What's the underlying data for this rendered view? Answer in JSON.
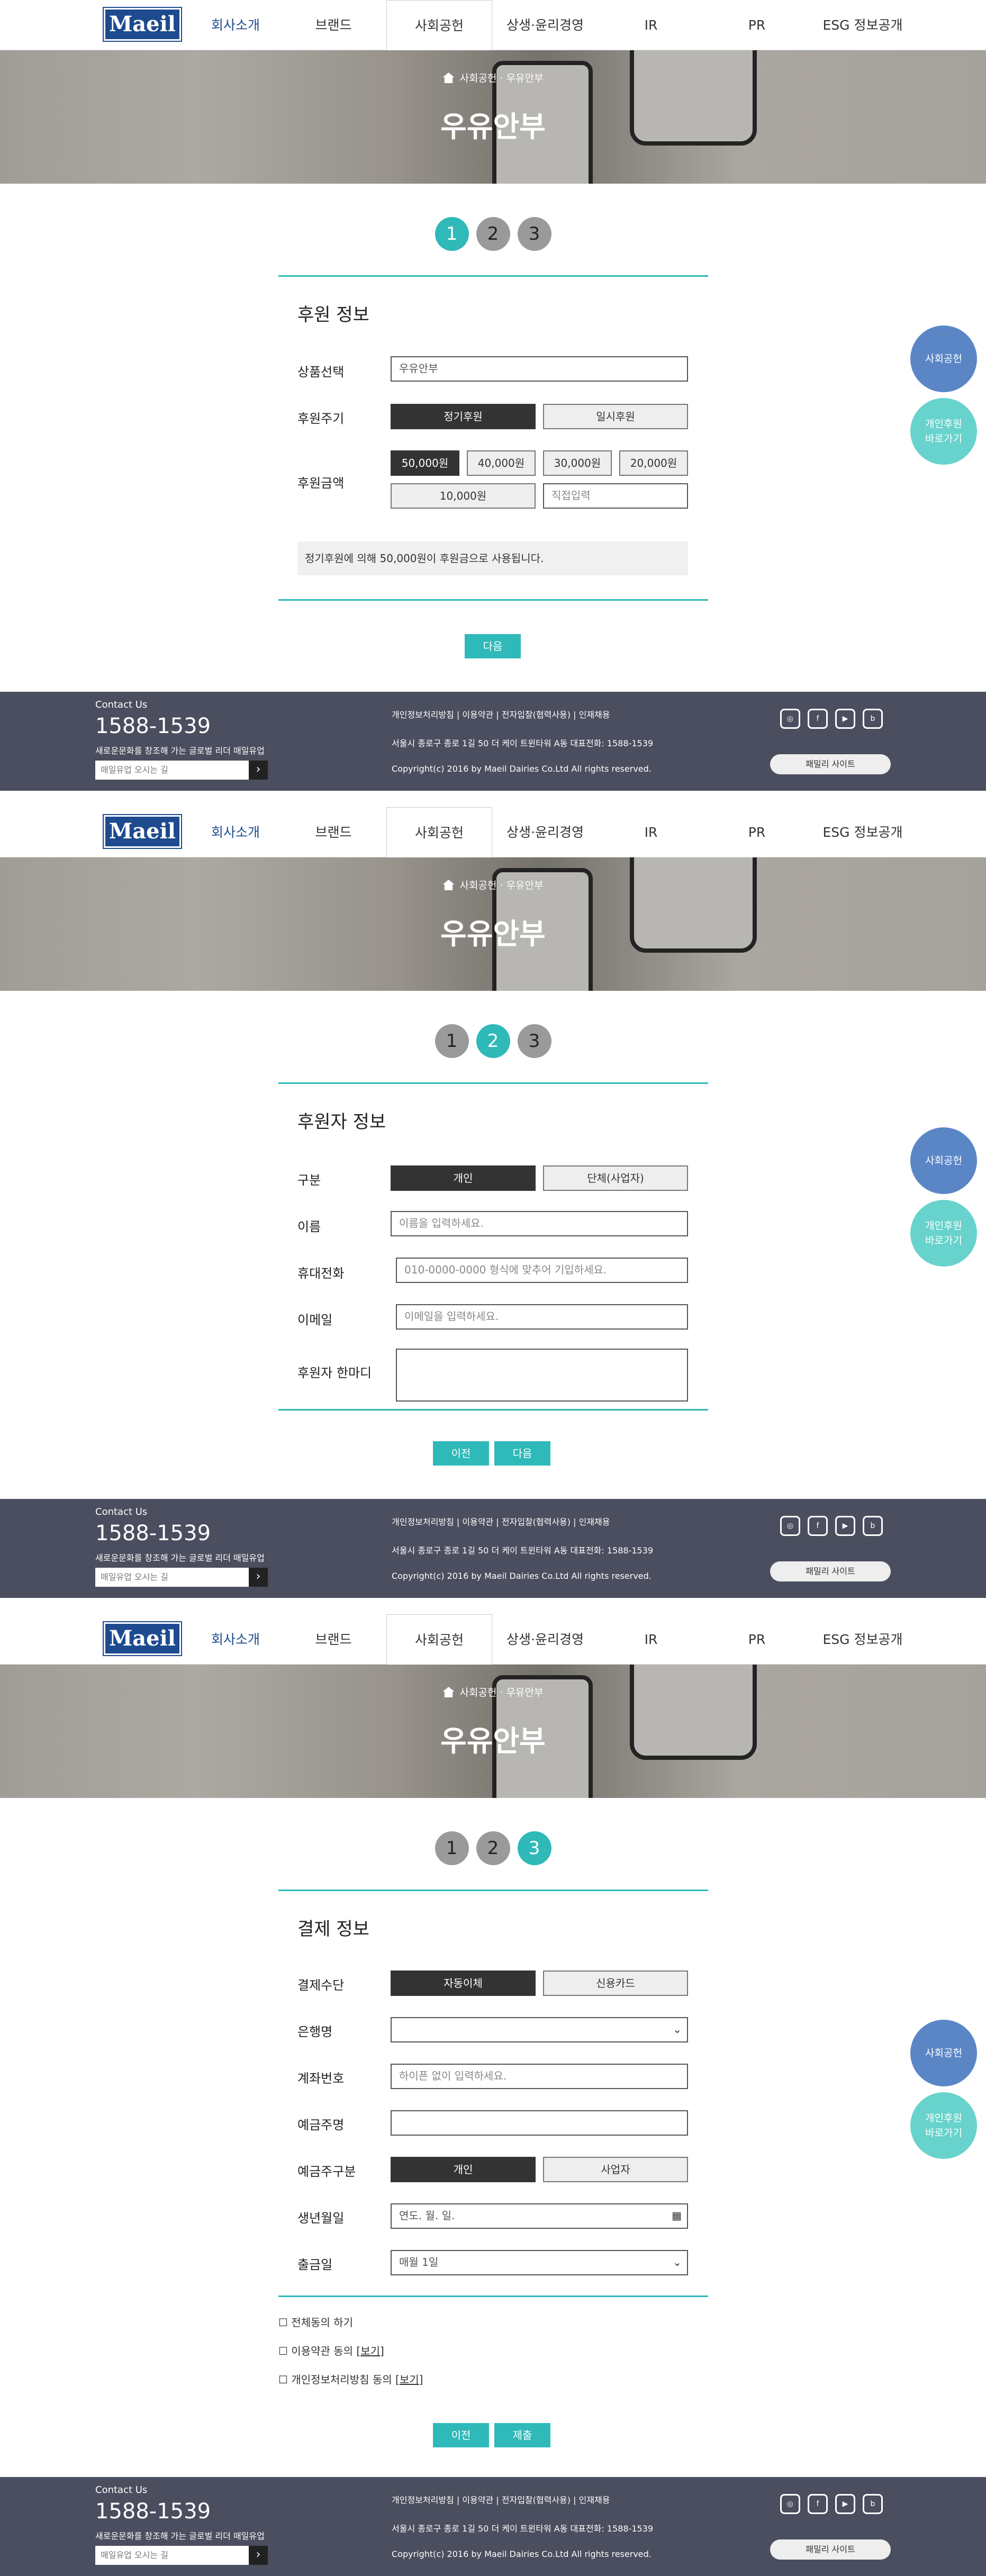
{
  "header": {
    "logo": "Maeil",
    "nav": [
      "회사소개",
      "브랜드",
      "사회공헌",
      "상생·윤리경영",
      "IR",
      "PR",
      "ESG 정보공개"
    ]
  },
  "hero": {
    "breadcrumb": "사회공헌 · 우유안부",
    "title": "우유안부"
  },
  "floating": {
    "social": "사회공헌",
    "privacy_line1": "개인후원",
    "privacy_line2": "바로가기"
  },
  "footer": {
    "contact": "Contact Us",
    "tel": "1588-1539",
    "slogan": "새로운문화를 창조해 가는 글로벌 리더 매일유업",
    "search_placeholder": "매일유업 오시는 길",
    "search_btn": "›",
    "links": "개인정보처리방침 | 이용약관 | 전자입찰(협력사용) | 인재채용",
    "address": "서울시 종로구 종로 1길 50 더 케이 트윈타워 A동 대표전화: 1588-1539",
    "copyright": "Copyright(c) 2016 by Maeil Dairies Co.Ltd All rights reserved.",
    "icons": [
      "instagram-icon",
      "facebook-icon",
      "youtube-icon",
      "blog-icon"
    ],
    "family": "패밀리 사이트"
  },
  "step1": {
    "steps": [
      "1",
      "2",
      "3"
    ],
    "heading": "후원 정보",
    "product_label": "상품선택",
    "product_value": "우유안부",
    "cycle_label": "후원주기",
    "cycle_regular": "정기후원",
    "cycle_once": "일시후원",
    "amount_label": "후원금액",
    "amounts": [
      "50,000원",
      "40,000원",
      "30,000원",
      "20,000원"
    ],
    "amount_10000": "10,000원",
    "amount_custom": "직접입력",
    "notice": "정기후원에 의해  50,000원이 후원금으로 사용됩니다.",
    "next": "다음"
  },
  "step2": {
    "steps": [
      "1",
      "2",
      "3"
    ],
    "heading": "후원자 정보",
    "type_label": "구분",
    "type_personal": "개인",
    "type_group": "단체(사업자)",
    "name_label": "이름",
    "name_ph": "이름을 입력하세요.",
    "phone_label": "휴대전화",
    "phone_ph": "010-0000-0000 형식에 맞추어 기입하세요.",
    "email_label": "이메일",
    "email_ph": "이메일을 입력하세요.",
    "message_label": "후원자 한마디",
    "prev": "이전",
    "next": "다음"
  },
  "step3": {
    "steps": [
      "1",
      "2",
      "3"
    ],
    "heading": "결제 정보",
    "method_label": "결제수단",
    "method_auto": "자동이체",
    "method_card": "신용카드",
    "bank_label": "은행명",
    "account_label": "계좌번호",
    "account_ph": "하이픈 없이 입력하세요.",
    "holder_label": "예금주명",
    "holder_type_label": "예금주구분",
    "holder_personal": "개인",
    "holder_business": "사업자",
    "birth_label": "생년월일",
    "birth_ph": "연도. 월. 일.",
    "withdraw_label": "출금일",
    "withdraw_value": "매월 1일",
    "agree_all": "전체동의 하기",
    "agree_terms": "이용약관 동의",
    "agree_privacy": "개인정보처리방침 동의",
    "view": "보기",
    "prev": "이전",
    "submit": "제출"
  }
}
